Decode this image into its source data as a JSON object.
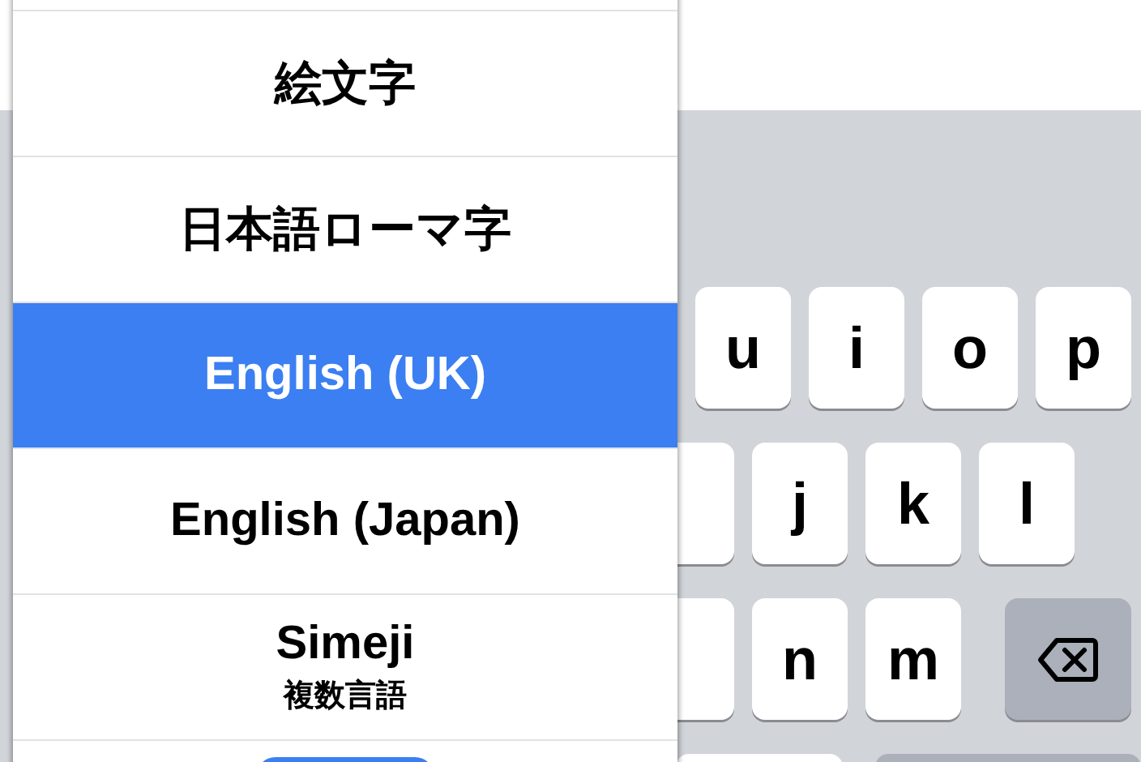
{
  "keyboard": {
    "rows": [
      {
        "keys": [
          {
            "kind": "letter",
            "label": "u"
          },
          {
            "kind": "letter",
            "label": "i"
          },
          {
            "kind": "letter",
            "label": "o"
          },
          {
            "kind": "letter",
            "label": "p"
          }
        ]
      },
      {
        "keys": [
          {
            "kind": "partial"
          },
          {
            "kind": "letter",
            "label": "j"
          },
          {
            "kind": "letter",
            "label": "k"
          },
          {
            "kind": "letter",
            "label": "l"
          }
        ]
      },
      {
        "keys": [
          {
            "kind": "partial"
          },
          {
            "kind": "letter",
            "label": "n"
          },
          {
            "kind": "letter",
            "label": "m"
          },
          {
            "kind": "delete"
          }
        ]
      },
      {
        "keys": [
          {
            "kind": "space"
          },
          {
            "kind": "return"
          }
        ]
      }
    ]
  },
  "input_menu": {
    "items": [
      {
        "label": "絵文字",
        "selected": false
      },
      {
        "label": "日本語ローマ字",
        "selected": false
      },
      {
        "label": "English (UK)",
        "selected": true
      },
      {
        "label": "English (Japan)",
        "selected": false
      },
      {
        "label": "Simeji",
        "subtitle": "複数言語",
        "selected": false
      }
    ]
  }
}
